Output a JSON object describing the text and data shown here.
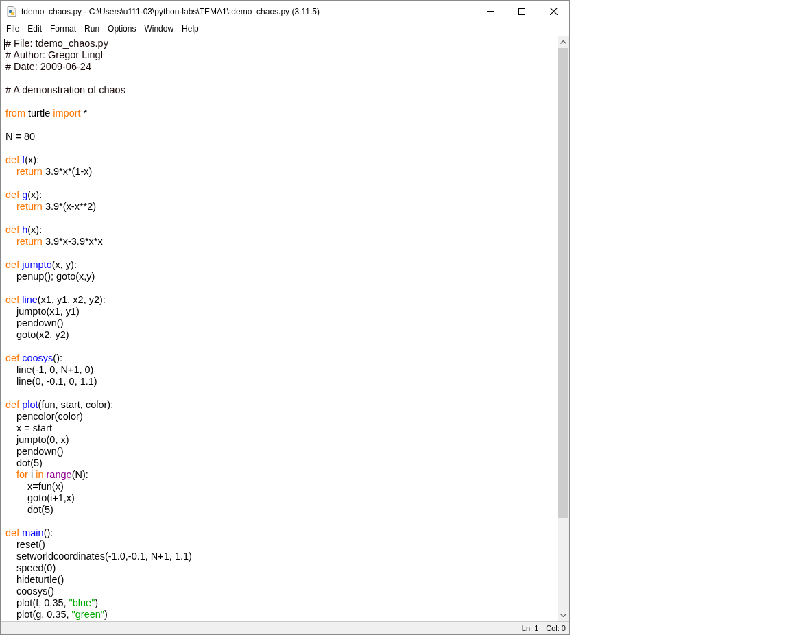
{
  "window": {
    "title": "tdemo_chaos.py - C:\\Users\\u111-03\\python-labs\\TEMA1\\tdemo_chaos.py (3.11.5)"
  },
  "menu": [
    "File",
    "Edit",
    "Format",
    "Run",
    "Options",
    "Window",
    "Help"
  ],
  "code": [
    {
      "kind": "code",
      "tokens": [
        {
          "kind": "comment",
          "text": "# File: tdemo_chaos.py"
        }
      ]
    },
    {
      "kind": "code",
      "tokens": [
        {
          "kind": "comment",
          "text": "# Author: Gregor Lingl"
        }
      ]
    },
    {
      "kind": "code",
      "tokens": [
        {
          "kind": "comment",
          "text": "# Date: 2009-06-24"
        }
      ]
    },
    {
      "kind": "blank"
    },
    {
      "kind": "code",
      "tokens": [
        {
          "kind": "comment",
          "text": "# A demonstration of chaos"
        }
      ]
    },
    {
      "kind": "blank"
    },
    {
      "kind": "code",
      "tokens": [
        {
          "kind": "keyword",
          "text": "from"
        },
        {
          "kind": "plain",
          "text": " turtle "
        },
        {
          "kind": "keyword",
          "text": "import"
        },
        {
          "kind": "plain",
          "text": " *"
        }
      ]
    },
    {
      "kind": "blank"
    },
    {
      "kind": "code",
      "tokens": [
        {
          "kind": "plain",
          "text": "N = 80"
        }
      ]
    },
    {
      "kind": "blank"
    },
    {
      "kind": "code",
      "tokens": [
        {
          "kind": "keyword",
          "text": "def "
        },
        {
          "kind": "defname",
          "text": "f"
        },
        {
          "kind": "plain",
          "text": "(x):"
        }
      ],
      "children": [
        {
          "kind": "code",
          "tokens": [
            {
              "kind": "keyword",
              "text": "return"
            },
            {
              "kind": "plain",
              "text": " 3.9*x*(1-x)"
            }
          ]
        }
      ]
    },
    {
      "kind": "blank"
    },
    {
      "kind": "code",
      "tokens": [
        {
          "kind": "keyword",
          "text": "def "
        },
        {
          "kind": "defname",
          "text": "g"
        },
        {
          "kind": "plain",
          "text": "(x):"
        }
      ],
      "children": [
        {
          "kind": "code",
          "tokens": [
            {
              "kind": "keyword",
              "text": "return"
            },
            {
              "kind": "plain",
              "text": " 3.9*(x-x**2)"
            }
          ]
        }
      ]
    },
    {
      "kind": "blank"
    },
    {
      "kind": "code",
      "tokens": [
        {
          "kind": "keyword",
          "text": "def "
        },
        {
          "kind": "defname",
          "text": "h"
        },
        {
          "kind": "plain",
          "text": "(x):"
        }
      ],
      "children": [
        {
          "kind": "code",
          "tokens": [
            {
              "kind": "keyword",
              "text": "return"
            },
            {
              "kind": "plain",
              "text": " 3.9*x-3.9*x*x"
            }
          ]
        }
      ]
    },
    {
      "kind": "blank"
    },
    {
      "kind": "code",
      "tokens": [
        {
          "kind": "keyword",
          "text": "def "
        },
        {
          "kind": "defname",
          "text": "jumpto"
        },
        {
          "kind": "plain",
          "text": "(x, y):"
        }
      ],
      "children": [
        {
          "kind": "code",
          "tokens": [
            {
              "kind": "plain",
              "text": "penup(); goto(x,y)"
            }
          ]
        }
      ]
    },
    {
      "kind": "blank"
    },
    {
      "kind": "code",
      "tokens": [
        {
          "kind": "keyword",
          "text": "def "
        },
        {
          "kind": "defname",
          "text": "line"
        },
        {
          "kind": "plain",
          "text": "(x1, y1, x2, y2):"
        }
      ],
      "children": [
        {
          "kind": "code",
          "tokens": [
            {
              "kind": "plain",
              "text": "jumpto(x1, y1)"
            }
          ]
        },
        {
          "kind": "code",
          "tokens": [
            {
              "kind": "plain",
              "text": "pendown()"
            }
          ]
        },
        {
          "kind": "code",
          "tokens": [
            {
              "kind": "plain",
              "text": "goto(x2, y2)"
            }
          ]
        }
      ]
    },
    {
      "kind": "blank"
    },
    {
      "kind": "code",
      "tokens": [
        {
          "kind": "keyword",
          "text": "def "
        },
        {
          "kind": "defname",
          "text": "coosys"
        },
        {
          "kind": "plain",
          "text": "():"
        }
      ],
      "children": [
        {
          "kind": "code",
          "tokens": [
            {
              "kind": "plain",
              "text": "line(-1, 0, N+1, 0)"
            }
          ]
        },
        {
          "kind": "code",
          "tokens": [
            {
              "kind": "plain",
              "text": "line(0, -0.1, 0, 1.1)"
            }
          ]
        }
      ]
    },
    {
      "kind": "blank"
    },
    {
      "kind": "code",
      "tokens": [
        {
          "kind": "keyword",
          "text": "def "
        },
        {
          "kind": "defname",
          "text": "plot"
        },
        {
          "kind": "plain",
          "text": "(fun, start, color):"
        }
      ],
      "children": [
        {
          "kind": "code",
          "tokens": [
            {
              "kind": "plain",
              "text": "pencolor(color)"
            }
          ]
        },
        {
          "kind": "code",
          "tokens": [
            {
              "kind": "plain",
              "text": "x = start"
            }
          ]
        },
        {
          "kind": "code",
          "tokens": [
            {
              "kind": "plain",
              "text": "jumpto(0, x)"
            }
          ]
        },
        {
          "kind": "code",
          "tokens": [
            {
              "kind": "plain",
              "text": "pendown()"
            }
          ]
        },
        {
          "kind": "code",
          "tokens": [
            {
              "kind": "plain",
              "text": "dot(5)"
            }
          ]
        },
        {
          "kind": "code",
          "tokens": [
            {
              "kind": "keyword",
              "text": "for"
            },
            {
              "kind": "plain",
              "text": " i "
            },
            {
              "kind": "keyword",
              "text": "in "
            },
            {
              "kind": "builtin",
              "text": "range"
            },
            {
              "kind": "plain",
              "text": "(N):"
            }
          ],
          "children": [
            {
              "kind": "code",
              "tokens": [
                {
                  "kind": "plain",
                  "text": "x=fun(x)"
                }
              ]
            },
            {
              "kind": "code",
              "tokens": [
                {
                  "kind": "plain",
                  "text": "goto(i+1,x)"
                }
              ]
            },
            {
              "kind": "code",
              "tokens": [
                {
                  "kind": "plain",
                  "text": "dot(5)"
                }
              ]
            }
          ]
        }
      ]
    },
    {
      "kind": "blank"
    },
    {
      "kind": "code",
      "tokens": [
        {
          "kind": "keyword",
          "text": "def "
        },
        {
          "kind": "defname",
          "text": "main"
        },
        {
          "kind": "plain",
          "text": "():"
        }
      ],
      "children": [
        {
          "kind": "code",
          "tokens": [
            {
              "kind": "plain",
              "text": "reset()"
            }
          ]
        },
        {
          "kind": "code",
          "tokens": [
            {
              "kind": "plain",
              "text": "setworldcoordinates(-1.0,-0.1, N+1, 1.1)"
            }
          ]
        },
        {
          "kind": "code",
          "tokens": [
            {
              "kind": "plain",
              "text": "speed(0)"
            }
          ]
        },
        {
          "kind": "code",
          "tokens": [
            {
              "kind": "plain",
              "text": "hideturtle()"
            }
          ]
        },
        {
          "kind": "code",
          "tokens": [
            {
              "kind": "plain",
              "text": "coosys()"
            }
          ]
        },
        {
          "kind": "code",
          "tokens": [
            {
              "kind": "plain",
              "text": "plot(f, 0.35, "
            },
            {
              "kind": "string",
              "text": "\"blue\""
            },
            {
              "kind": "plain",
              "text": ")"
            }
          ]
        },
        {
          "kind": "code",
          "tokens": [
            {
              "kind": "plain",
              "text": "plot(g, 0.35, "
            },
            {
              "kind": "string",
              "text": "\"green\""
            },
            {
              "kind": "plain",
              "text": ")"
            }
          ]
        }
      ]
    }
  ],
  "status_bar": {
    "line": "Ln: 1",
    "column": "Col: 0"
  }
}
